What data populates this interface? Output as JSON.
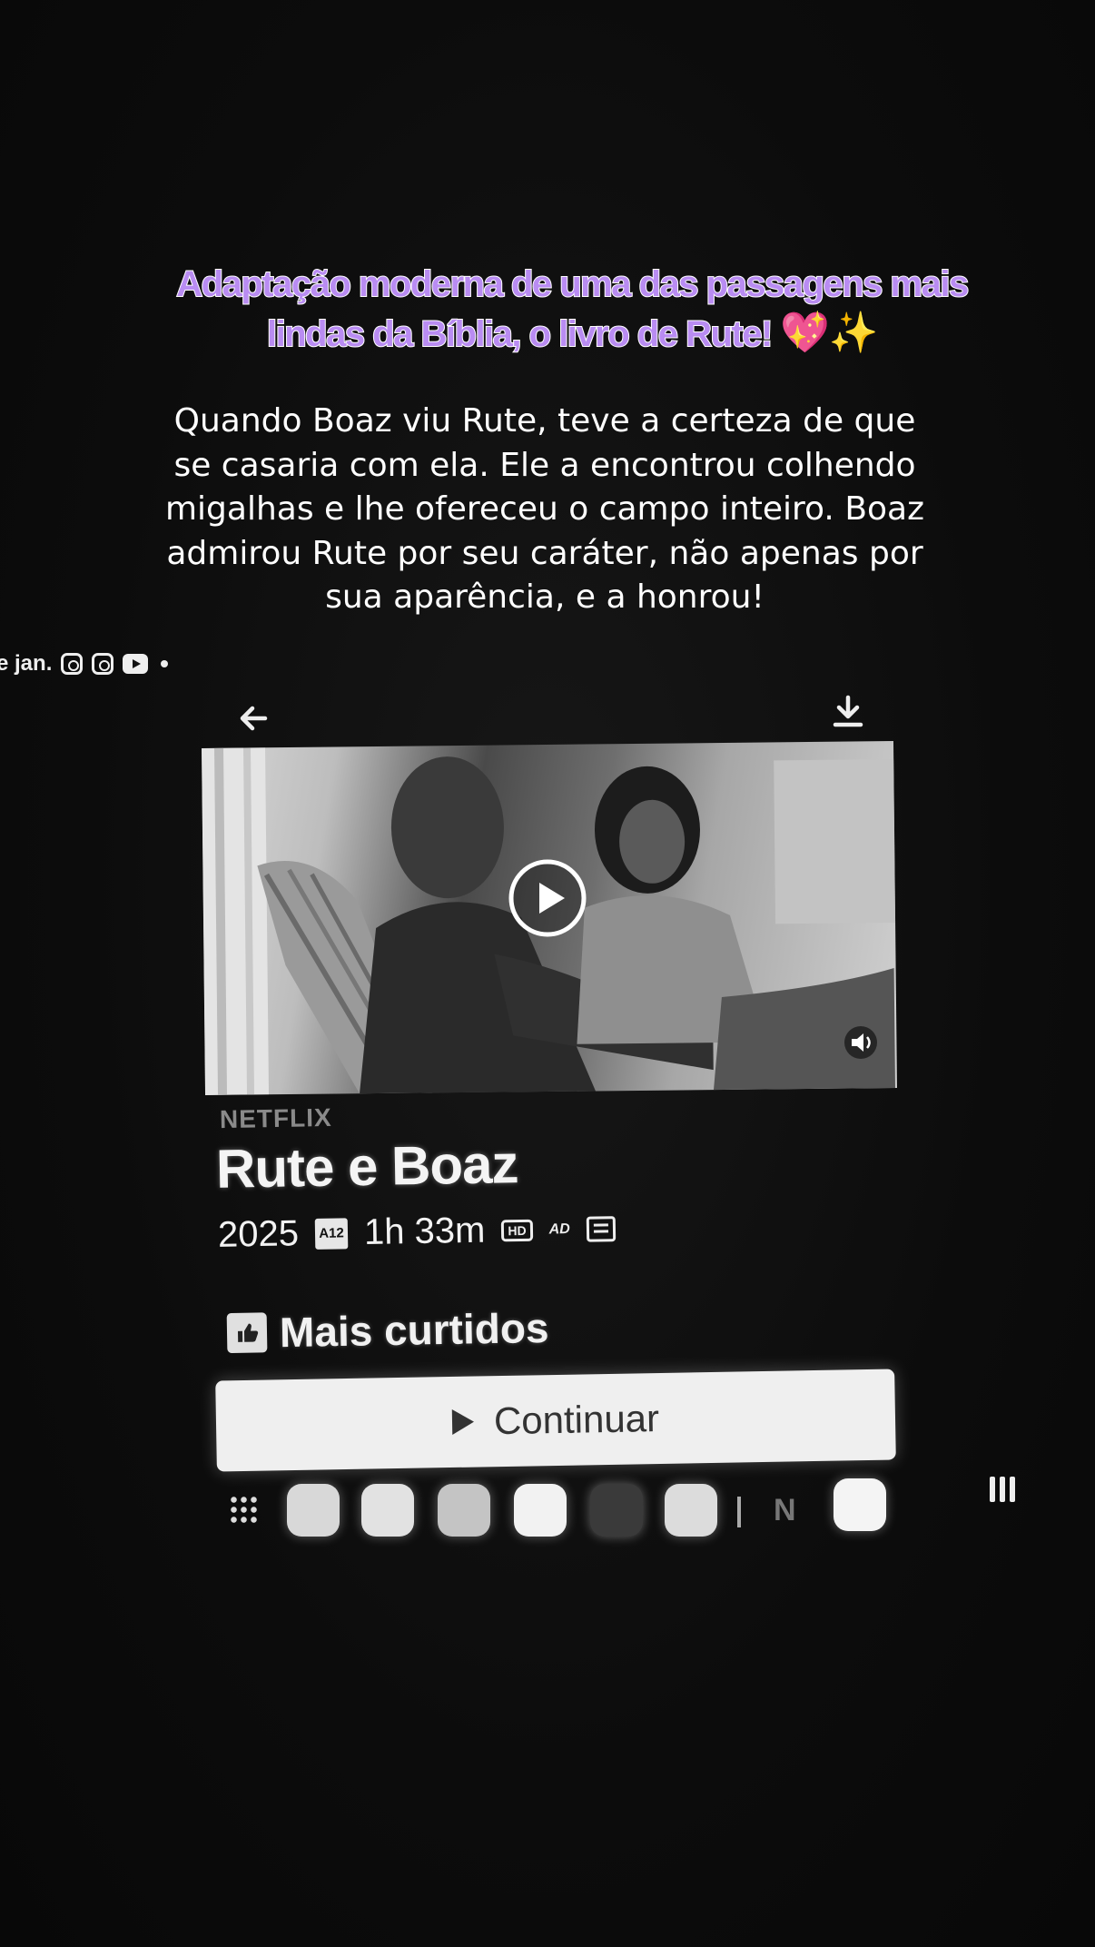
{
  "caption": {
    "highlight_line1": "Adaptação moderna de uma das passagens mais",
    "highlight_line2": "lindas da Bíblia, o livro de Rute!",
    "highlight_emojis": "💖✨",
    "body": "Quando Boaz viu Rute, teve a certeza de que se casaria com ela. Ele a encontrou colhendo migalhas e lhe ofereceu o campo inteiro. Boaz admirou Rute por seu caráter, não apenas por sua aparência, e a honrou!",
    "colors": {
      "highlight": "#b98cf2",
      "outline": "#ffffff"
    }
  },
  "story_meta": {
    "date_fragment": "e jan.",
    "icons": [
      "instagram-icon",
      "instagram-icon",
      "youtube-icon",
      "dot-icon"
    ]
  },
  "header": {
    "back_icon": "arrow-left-icon",
    "download_icon": "download-icon"
  },
  "hero": {
    "play_icon": "play-circle-icon",
    "mute_icon": "volume-icon"
  },
  "title_info": {
    "brand": "NETFLIX",
    "title": "Rute e Boaz",
    "year": "2025",
    "rating": "A12",
    "duration": "1h 33m",
    "badges": [
      "HD",
      "AD"
    ],
    "subtitles_icon": "subtitles-icon"
  },
  "top_badge": {
    "icon": "thumbs-up-icon",
    "label": "Mais curtidos"
  },
  "actions": {
    "continue_label": "Continuar"
  },
  "dock": {
    "apps": [
      "notes-app",
      "messages-app",
      "phone-app",
      "chat-app",
      "browser-app",
      "camera-app",
      "netflix-app",
      "youtube-app"
    ]
  }
}
